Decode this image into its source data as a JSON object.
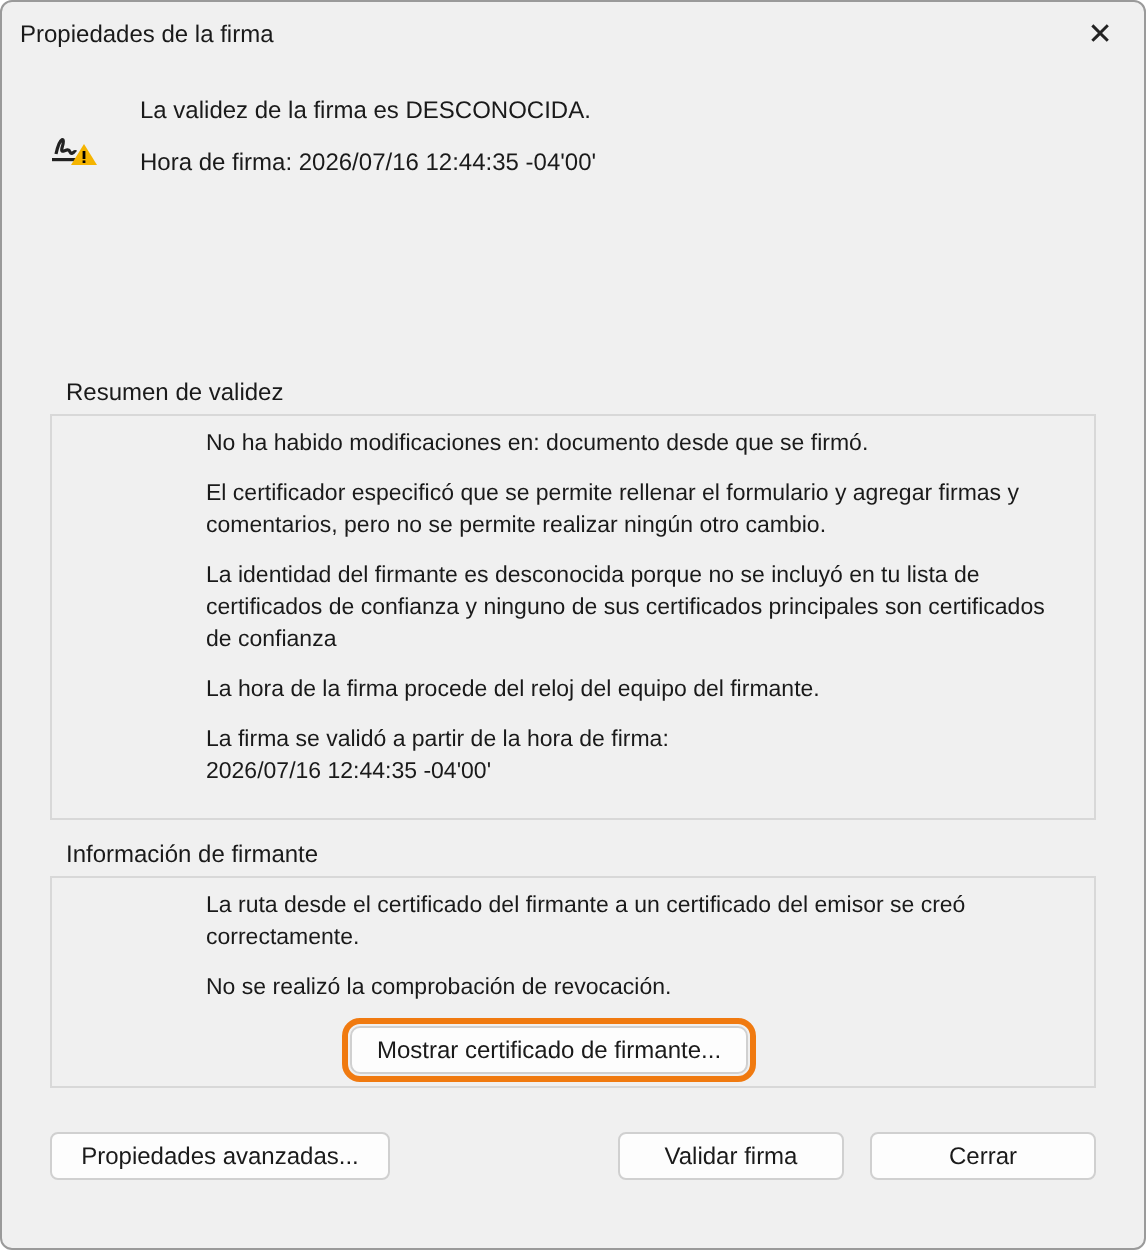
{
  "window": {
    "title": "Propiedades de la firma",
    "close": "✕"
  },
  "status": {
    "validity": "La validez de la firma es DESCONOCIDA.",
    "signing_time": "Hora de firma:  2026/07/16 12:44:35 -04'00'"
  },
  "groups": [
    {
      "title": "Resumen de validez",
      "paragraphs": [
        "No ha habido modificaciones en: documento desde que se firmó.",
        "El certificador especificó que se permite rellenar el formulario y agregar firmas y comentarios, pero no se permite realizar ningún otro cambio.",
        "La identidad del firmante es desconocida porque no se incluyó en tu lista de certificados de confianza y ninguno de sus certificados principales son certificados de confianza",
        "La hora de la firma procede del reloj del equipo del firmante.",
        "La firma se validó a partir de la hora de firma:\n2026/07/16 12:44:35 -04'00'"
      ]
    },
    {
      "title": "Información de firmante",
      "paragraphs": [
        "La ruta desde el certificado del firmante a un certificado del emisor se creó correctamente.",
        "No se realizó la comprobación de revocación."
      ],
      "button": {
        "label": "Mostrar certificado de firmante...",
        "highlighted": true
      }
    }
  ],
  "buttons": [
    {
      "label": "Propiedades avanzadas...",
      "highlighted": false
    },
    {
      "label": "Validar firma",
      "highlighted": false
    },
    {
      "label": "Cerrar",
      "highlighted": false
    }
  ]
}
